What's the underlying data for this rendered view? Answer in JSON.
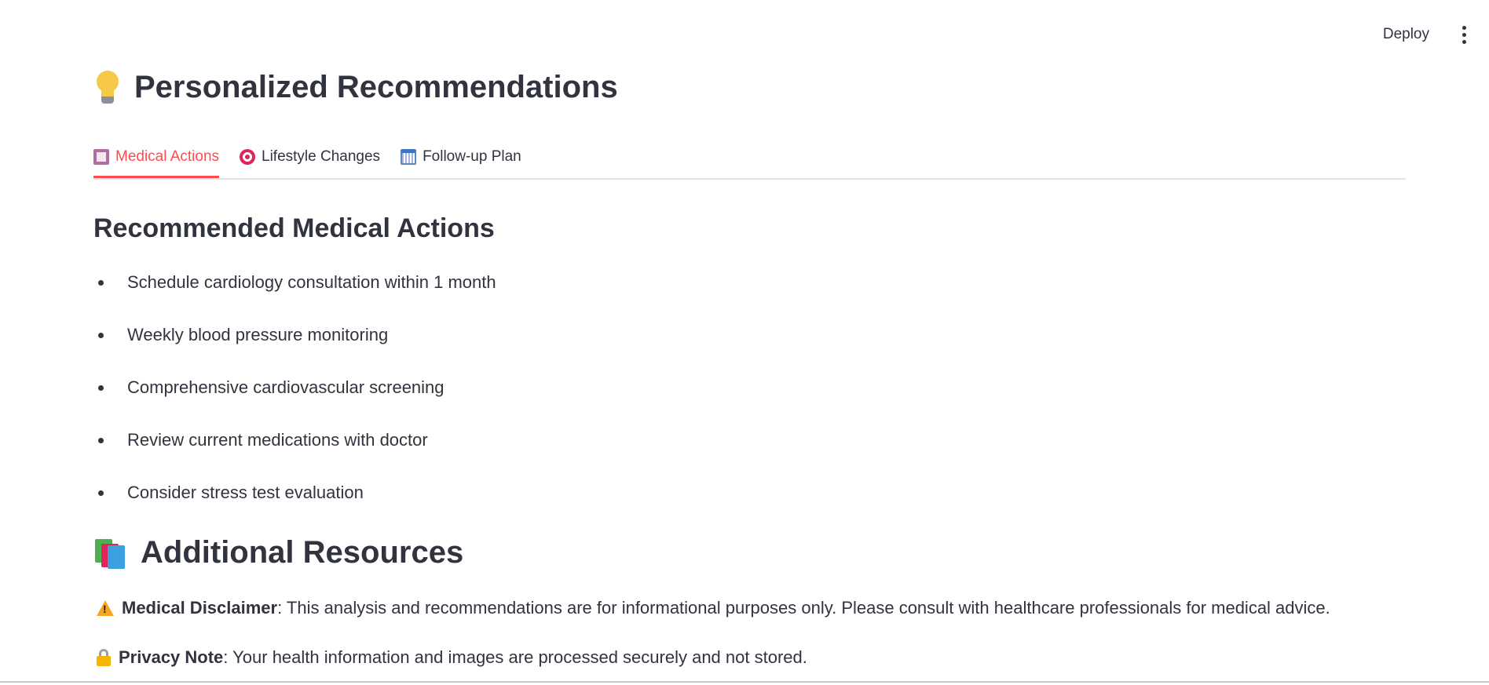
{
  "header": {
    "deploy_label": "Deploy",
    "menu_icon": "more-vertical-icon"
  },
  "page": {
    "title": "Personalized Recommendations",
    "title_icon": "lightbulb-icon"
  },
  "tabs": [
    {
      "label": "Medical Actions",
      "icon": "clipboard-icon",
      "active": true
    },
    {
      "label": "Lifestyle Changes",
      "icon": "target-icon",
      "active": false
    },
    {
      "label": "Follow-up Plan",
      "icon": "calendar-icon",
      "active": false
    }
  ],
  "medical_actions": {
    "heading": "Recommended Medical Actions",
    "items": [
      "Schedule cardiology consultation within 1 month",
      "Weekly blood pressure monitoring",
      "Comprehensive cardiovascular screening",
      "Review current medications with doctor",
      "Consider stress test evaluation"
    ]
  },
  "resources": {
    "title": "Additional Resources",
    "title_icon": "books-icon",
    "disclaimer_label": "Medical Disclaimer",
    "disclaimer_text": ": This analysis and recommendations are for informational purposes only. Please consult with healthcare professionals for medical advice.",
    "privacy_label": "Privacy Note",
    "privacy_text": ": Your health information and images are processed securely and not stored."
  },
  "colors": {
    "accent": "#ff4b4b",
    "text": "#31333f",
    "tab_border": "#e6e6ea"
  }
}
